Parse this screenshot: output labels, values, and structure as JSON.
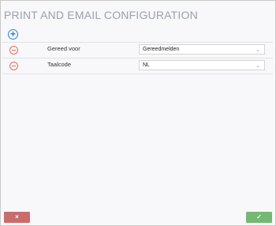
{
  "header": {
    "title": "PRINT AND EMAIL CONFIGURATION"
  },
  "toolbar": {
    "add_icon": "plus-circle-icon"
  },
  "rows": [
    {
      "label": "Gereed voor",
      "value": "Gereedmelden",
      "remove_icon": "minus-circle-icon"
    },
    {
      "label": "Taalcode",
      "value": "NL",
      "remove_icon": "minus-circle-icon"
    }
  ],
  "footer": {
    "cancel_icon": "×",
    "ok_icon": "✓"
  },
  "colors": {
    "add": "#2f7fd1",
    "remove": "#e56c55",
    "cancel": "#c96c6c",
    "ok": "#74b873",
    "title": "#9aa0ac"
  }
}
